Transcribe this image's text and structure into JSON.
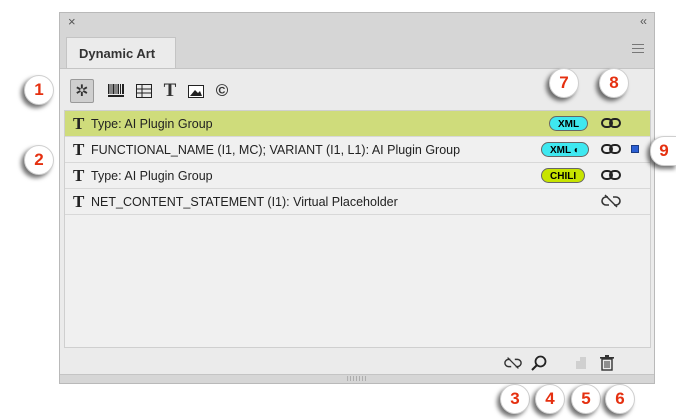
{
  "panel": {
    "close_glyph": "×",
    "collapse_glyph": "‹‹",
    "tab_title": "Dynamic Art"
  },
  "toolbar": {
    "tools": [
      {
        "icon": "gear-icon",
        "glyph": "✲",
        "active": true
      },
      {
        "icon": "barcode-icon",
        "glyph": "▥"
      },
      {
        "icon": "table-icon",
        "glyph": "▤"
      },
      {
        "icon": "text-icon",
        "glyph": "T"
      },
      {
        "icon": "image-icon",
        "glyph": "▭"
      },
      {
        "icon": "copyright-icon",
        "glyph": "©"
      }
    ]
  },
  "rows": [
    {
      "type_glyph": "T",
      "label": "Type: AI Plugin Group",
      "badge": "XML",
      "badge_kind": "xml",
      "link": "linked",
      "selected": true
    },
    {
      "type_glyph": "T",
      "label": "FUNCTIONAL_NAME (I1, MC); VARIANT (I1, L1): AI Plugin Group",
      "badge": "XML ◐",
      "badge_kind": "xml",
      "link": "linked",
      "square": true
    },
    {
      "type_glyph": "T",
      "label": "Type: AI Plugin Group",
      "badge": "CHILI",
      "badge_kind": "chili",
      "link": "linked"
    },
    {
      "type_glyph": "T",
      "label": "NET_CONTENT_STATEMENT (I1): Virtual Placeholder",
      "badge": "",
      "link": "unlinked"
    }
  ],
  "bottom": {
    "icons": [
      "unlink-icon",
      "search-icon",
      "new-page-icon",
      "trash-icon"
    ]
  },
  "grip_text": "IIIIIII",
  "callouts": [
    "1",
    "2",
    "3",
    "4",
    "5",
    "6",
    "7",
    "8",
    "9"
  ],
  "colors": {
    "selected_row": "#cfdc7b",
    "xml_badge": "#3ee8f0",
    "chili_badge": "#c7e400",
    "callout_number": "#e53010"
  }
}
